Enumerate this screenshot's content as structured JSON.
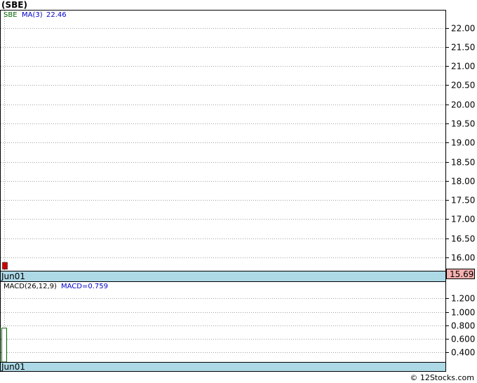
{
  "header": {
    "title": "(SBE)"
  },
  "footer": {
    "copyright": "© 12Stocks.com"
  },
  "colors": {
    "axis_band": "#add8e6",
    "grid": "#a0a0a0",
    "down_candle": "#cc0000",
    "macd_bar": "#006400",
    "legend_ticker": "#006400",
    "legend_ma": "#0000cc",
    "last_price_box": "#f4b0b0"
  },
  "chart_data": [
    {
      "type": "candlestick",
      "legend": {
        "ticker": "SBE",
        "ma_label": "MA(3)",
        "ma_value": "22.46"
      },
      "y_ticks": [
        "22.00",
        "21.50",
        "21.00",
        "20.50",
        "20.00",
        "19.50",
        "19.00",
        "18.50",
        "18.00",
        "17.50",
        "17.00",
        "16.50",
        "16.00"
      ],
      "x_labels": [
        "Jun01"
      ],
      "ylim": [
        15.65,
        22.45
      ],
      "grid": true,
      "candles": [
        {
          "date": "Jun01",
          "open": 15.87,
          "high": 15.87,
          "low": 15.69,
          "close": 15.69
        }
      ],
      "last_price": "15.69"
    },
    {
      "type": "bar",
      "legend": {
        "label": "MACD(26,12,9)",
        "value_label": "MACD=0.759"
      },
      "y_ticks": [
        "1.200",
        "1.000",
        "0.800",
        "0.600",
        "0.400"
      ],
      "x_labels": [
        "Jun01"
      ],
      "ylim": [
        0.26,
        1.44
      ],
      "grid": true,
      "bars": [
        {
          "date": "Jun01",
          "value": 0.759
        }
      ]
    }
  ]
}
